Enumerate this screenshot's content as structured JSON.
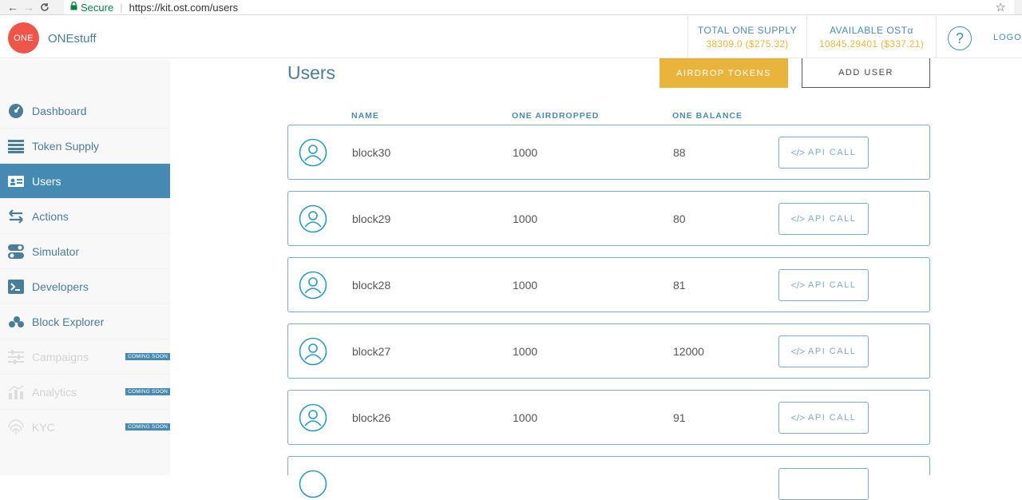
{
  "browser": {
    "back": "←",
    "forward": "→",
    "reload": "C",
    "secure_label": "Secure",
    "url": "https://kit.ost.com/users",
    "star": "☆"
  },
  "header": {
    "logo_text": "ONE",
    "brand": "ONEstuff",
    "total_supply_label": "TOTAL ONE SUPPLY",
    "total_supply_value": "38309.0 ($275.32)",
    "available_label": "AVAILABLE OSTα",
    "available_value": "10845.29401 ($337.21)",
    "help": "?",
    "logout": "LOGO"
  },
  "sidebar": {
    "items": [
      {
        "label": "Dashboard",
        "icon": "dashboard-icon"
      },
      {
        "label": "Token Supply",
        "icon": "token-supply-icon"
      },
      {
        "label": "Users",
        "icon": "users-icon",
        "active": true
      },
      {
        "label": "Actions",
        "icon": "actions-icon"
      },
      {
        "label": "Simulator",
        "icon": "simulator-icon"
      },
      {
        "label": "Developers",
        "icon": "developers-icon"
      },
      {
        "label": "Block Explorer",
        "icon": "block-explorer-icon"
      },
      {
        "label": "Campaigns",
        "icon": "campaigns-icon",
        "disabled": true,
        "badge": "COMING SOON"
      },
      {
        "label": "Analytics",
        "icon": "analytics-icon",
        "disabled": true,
        "badge": "COMING SOON"
      },
      {
        "label": "KYC",
        "icon": "fingerprint-icon",
        "disabled": true,
        "badge": "COMING SOON"
      }
    ]
  },
  "main": {
    "title": "Users",
    "airdrop_button": "AIRDROP TOKENS",
    "add_user_button": "ADD USER",
    "columns": [
      "NAME",
      "ONE AIRDROPPED",
      "ONE BALANCE"
    ],
    "api_call_label": "API CALL",
    "api_call_glyph": "</>",
    "rows": [
      {
        "name": "block30",
        "airdropped": "1000",
        "balance": "88"
      },
      {
        "name": "block29",
        "airdropped": "1000",
        "balance": "80"
      },
      {
        "name": "block28",
        "airdropped": "1000",
        "balance": "81"
      },
      {
        "name": "block27",
        "airdropped": "1000",
        "balance": "12000"
      },
      {
        "name": "block26",
        "airdropped": "1000",
        "balance": "91"
      }
    ]
  },
  "colors": {
    "primary": "#468ab3",
    "accent": "#e8b43b",
    "logo": "#f0554a",
    "text": "#4a7d98"
  }
}
